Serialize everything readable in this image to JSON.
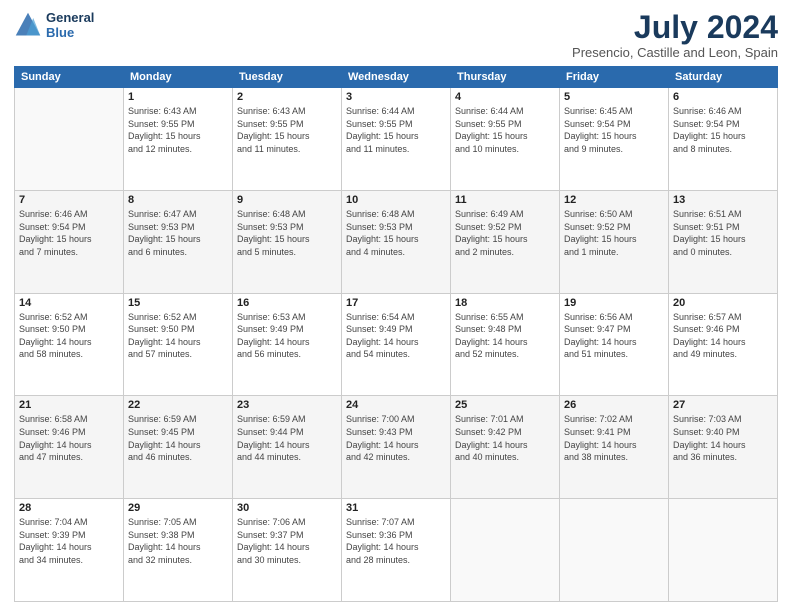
{
  "header": {
    "logo_line1": "General",
    "logo_line2": "Blue",
    "title": "July 2024",
    "subtitle": "Presencio, Castille and Leon, Spain"
  },
  "days_of_week": [
    "Sunday",
    "Monday",
    "Tuesday",
    "Wednesday",
    "Thursday",
    "Friday",
    "Saturday"
  ],
  "weeks": [
    [
      {
        "day": "",
        "info": ""
      },
      {
        "day": "1",
        "info": "Sunrise: 6:43 AM\nSunset: 9:55 PM\nDaylight: 15 hours\nand 12 minutes."
      },
      {
        "day": "2",
        "info": "Sunrise: 6:43 AM\nSunset: 9:55 PM\nDaylight: 15 hours\nand 11 minutes."
      },
      {
        "day": "3",
        "info": "Sunrise: 6:44 AM\nSunset: 9:55 PM\nDaylight: 15 hours\nand 11 minutes."
      },
      {
        "day": "4",
        "info": "Sunrise: 6:44 AM\nSunset: 9:55 PM\nDaylight: 15 hours\nand 10 minutes."
      },
      {
        "day": "5",
        "info": "Sunrise: 6:45 AM\nSunset: 9:54 PM\nDaylight: 15 hours\nand 9 minutes."
      },
      {
        "day": "6",
        "info": "Sunrise: 6:46 AM\nSunset: 9:54 PM\nDaylight: 15 hours\nand 8 minutes."
      }
    ],
    [
      {
        "day": "7",
        "info": "Sunrise: 6:46 AM\nSunset: 9:54 PM\nDaylight: 15 hours\nand 7 minutes."
      },
      {
        "day": "8",
        "info": "Sunrise: 6:47 AM\nSunset: 9:53 PM\nDaylight: 15 hours\nand 6 minutes."
      },
      {
        "day": "9",
        "info": "Sunrise: 6:48 AM\nSunset: 9:53 PM\nDaylight: 15 hours\nand 5 minutes."
      },
      {
        "day": "10",
        "info": "Sunrise: 6:48 AM\nSunset: 9:53 PM\nDaylight: 15 hours\nand 4 minutes."
      },
      {
        "day": "11",
        "info": "Sunrise: 6:49 AM\nSunset: 9:52 PM\nDaylight: 15 hours\nand 2 minutes."
      },
      {
        "day": "12",
        "info": "Sunrise: 6:50 AM\nSunset: 9:52 PM\nDaylight: 15 hours\nand 1 minute."
      },
      {
        "day": "13",
        "info": "Sunrise: 6:51 AM\nSunset: 9:51 PM\nDaylight: 15 hours\nand 0 minutes."
      }
    ],
    [
      {
        "day": "14",
        "info": "Sunrise: 6:52 AM\nSunset: 9:50 PM\nDaylight: 14 hours\nand 58 minutes."
      },
      {
        "day": "15",
        "info": "Sunrise: 6:52 AM\nSunset: 9:50 PM\nDaylight: 14 hours\nand 57 minutes."
      },
      {
        "day": "16",
        "info": "Sunrise: 6:53 AM\nSunset: 9:49 PM\nDaylight: 14 hours\nand 56 minutes."
      },
      {
        "day": "17",
        "info": "Sunrise: 6:54 AM\nSunset: 9:49 PM\nDaylight: 14 hours\nand 54 minutes."
      },
      {
        "day": "18",
        "info": "Sunrise: 6:55 AM\nSunset: 9:48 PM\nDaylight: 14 hours\nand 52 minutes."
      },
      {
        "day": "19",
        "info": "Sunrise: 6:56 AM\nSunset: 9:47 PM\nDaylight: 14 hours\nand 51 minutes."
      },
      {
        "day": "20",
        "info": "Sunrise: 6:57 AM\nSunset: 9:46 PM\nDaylight: 14 hours\nand 49 minutes."
      }
    ],
    [
      {
        "day": "21",
        "info": "Sunrise: 6:58 AM\nSunset: 9:46 PM\nDaylight: 14 hours\nand 47 minutes."
      },
      {
        "day": "22",
        "info": "Sunrise: 6:59 AM\nSunset: 9:45 PM\nDaylight: 14 hours\nand 46 minutes."
      },
      {
        "day": "23",
        "info": "Sunrise: 6:59 AM\nSunset: 9:44 PM\nDaylight: 14 hours\nand 44 minutes."
      },
      {
        "day": "24",
        "info": "Sunrise: 7:00 AM\nSunset: 9:43 PM\nDaylight: 14 hours\nand 42 minutes."
      },
      {
        "day": "25",
        "info": "Sunrise: 7:01 AM\nSunset: 9:42 PM\nDaylight: 14 hours\nand 40 minutes."
      },
      {
        "day": "26",
        "info": "Sunrise: 7:02 AM\nSunset: 9:41 PM\nDaylight: 14 hours\nand 38 minutes."
      },
      {
        "day": "27",
        "info": "Sunrise: 7:03 AM\nSunset: 9:40 PM\nDaylight: 14 hours\nand 36 minutes."
      }
    ],
    [
      {
        "day": "28",
        "info": "Sunrise: 7:04 AM\nSunset: 9:39 PM\nDaylight: 14 hours\nand 34 minutes."
      },
      {
        "day": "29",
        "info": "Sunrise: 7:05 AM\nSunset: 9:38 PM\nDaylight: 14 hours\nand 32 minutes."
      },
      {
        "day": "30",
        "info": "Sunrise: 7:06 AM\nSunset: 9:37 PM\nDaylight: 14 hours\nand 30 minutes."
      },
      {
        "day": "31",
        "info": "Sunrise: 7:07 AM\nSunset: 9:36 PM\nDaylight: 14 hours\nand 28 minutes."
      },
      {
        "day": "",
        "info": ""
      },
      {
        "day": "",
        "info": ""
      },
      {
        "day": "",
        "info": ""
      }
    ]
  ]
}
